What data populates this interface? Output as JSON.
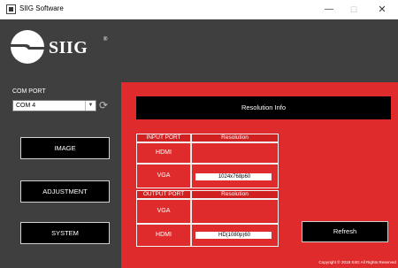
{
  "window": {
    "title": "SIIG Software",
    "minimize": "—",
    "maximize": "☐",
    "close": "✕"
  },
  "brand": {
    "name": "SIIG",
    "reg": "®"
  },
  "com_port": {
    "label": "COM PORT",
    "value": "COM 4"
  },
  "nav": {
    "image": "IMAGE",
    "adjustment": "ADJUSTMENT",
    "system": "SYSTEM"
  },
  "resolution_info": "Resolution Info",
  "input": {
    "port_header": "INPUT PORT",
    "res_header": "Resolution",
    "rows": [
      {
        "port": "HDMI",
        "value": ""
      },
      {
        "port": "VGA",
        "value": "1024x768p60"
      }
    ]
  },
  "output": {
    "port_header": "OUTPUT PORT",
    "res_header": "Resolution",
    "rows": [
      {
        "port": "VGA",
        "value": ""
      },
      {
        "port": "HDMI",
        "value": "HD(1080p)60"
      }
    ]
  },
  "refresh_label": "Refresh",
  "copyright": "Copyright © 2018 SIIG All Rights Reserved",
  "colors": {
    "panel_dark": "#3f3f3f",
    "panel_red": "#df2b2b",
    "button": "#000000"
  }
}
